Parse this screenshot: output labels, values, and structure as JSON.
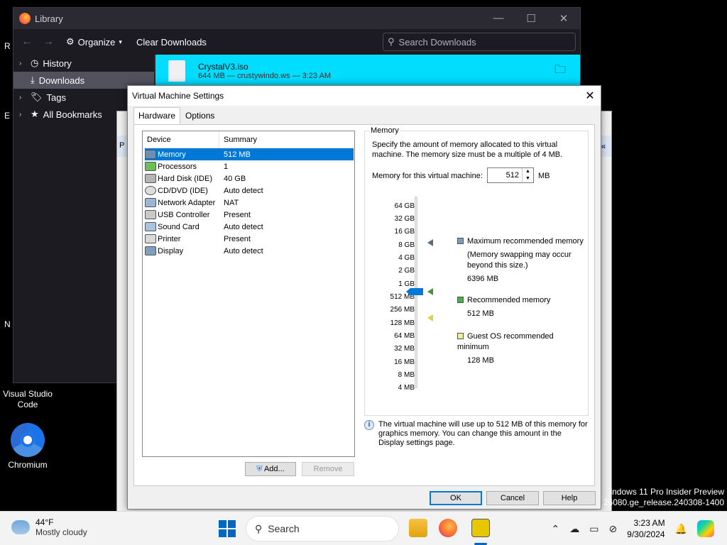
{
  "desktop": {
    "edge_letters": [
      "R",
      "E",
      "N"
    ],
    "icons": [
      {
        "label": "Visual Studio Code"
      },
      {
        "label": "Chromium"
      }
    ]
  },
  "library": {
    "title": "Library",
    "toolbar": {
      "organize": "Organize",
      "clear": "Clear Downloads",
      "search_placeholder": "Search Downloads"
    },
    "sidebar": [
      {
        "label": "History"
      },
      {
        "label": "Downloads"
      },
      {
        "label": "Tags"
      },
      {
        "label": "All Bookmarks"
      }
    ],
    "download": {
      "name": "CrystalV3.iso",
      "meta": "644 MB — crustywindo.ws — 3:23 AM"
    }
  },
  "bgwin": {
    "letter": "P",
    "chev": "«"
  },
  "dialog": {
    "title": "Virtual Machine Settings",
    "tabs": [
      "Hardware",
      "Options"
    ],
    "devices": {
      "headers": [
        "Device",
        "Summary"
      ],
      "rows": [
        {
          "device": "Memory",
          "summary": "512 MB",
          "icon": "memory-icon"
        },
        {
          "device": "Processors",
          "summary": "1",
          "icon": "processor-icon"
        },
        {
          "device": "Hard Disk (IDE)",
          "summary": "40 GB",
          "icon": "harddisk-icon"
        },
        {
          "device": "CD/DVD (IDE)",
          "summary": "Auto detect",
          "icon": "cd-icon"
        },
        {
          "device": "Network Adapter",
          "summary": "NAT",
          "icon": "network-icon"
        },
        {
          "device": "USB Controller",
          "summary": "Present",
          "icon": "usb-icon"
        },
        {
          "device": "Sound Card",
          "summary": "Auto detect",
          "icon": "sound-icon"
        },
        {
          "device": "Printer",
          "summary": "Present",
          "icon": "printer-icon"
        },
        {
          "device": "Display",
          "summary": "Auto detect",
          "icon": "display-icon"
        }
      ]
    },
    "add_button": "Add...",
    "remove_button": "Remove",
    "memory": {
      "group_label": "Memory",
      "description": "Specify the amount of memory allocated to this virtual machine. The memory size must be a multiple of 4 MB.",
      "field_label": "Memory for this virtual machine:",
      "value": "512",
      "unit": "MB",
      "scale": [
        "64 GB",
        "32 GB",
        "16 GB",
        "8 GB",
        "4 GB",
        "2 GB",
        "1 GB",
        "512 MB",
        "256 MB",
        "128 MB",
        "64 MB",
        "32 MB",
        "16 MB",
        "8 MB",
        "4 MB"
      ],
      "legend": {
        "max_title": "Maximum recommended memory",
        "max_note": "(Memory swapping may occur beyond this size.)",
        "max_value": "6396 MB",
        "rec_title": "Recommended memory",
        "rec_value": "512 MB",
        "min_title": "Guest OS recommended minimum",
        "min_value": "128 MB"
      },
      "colors": {
        "max": "#5a6d80",
        "rec": "#3a9a3a",
        "min": "#d6d640"
      }
    },
    "info": "The virtual machine will use up to 512 MB of this memory for graphics memory. You can change this amount in the Display settings page.",
    "ok": "OK",
    "cancel": "Cancel",
    "help": "Help"
  },
  "watermark": {
    "line1": "indows 11 Pro Insider Preview",
    "line2": "26080.ge_release.240308-1400"
  },
  "taskbar": {
    "weather_temp": "44°F",
    "weather_desc": "Mostly cloudy",
    "search": "Search",
    "time": "3:23 AM",
    "date": "9/30/2024"
  }
}
